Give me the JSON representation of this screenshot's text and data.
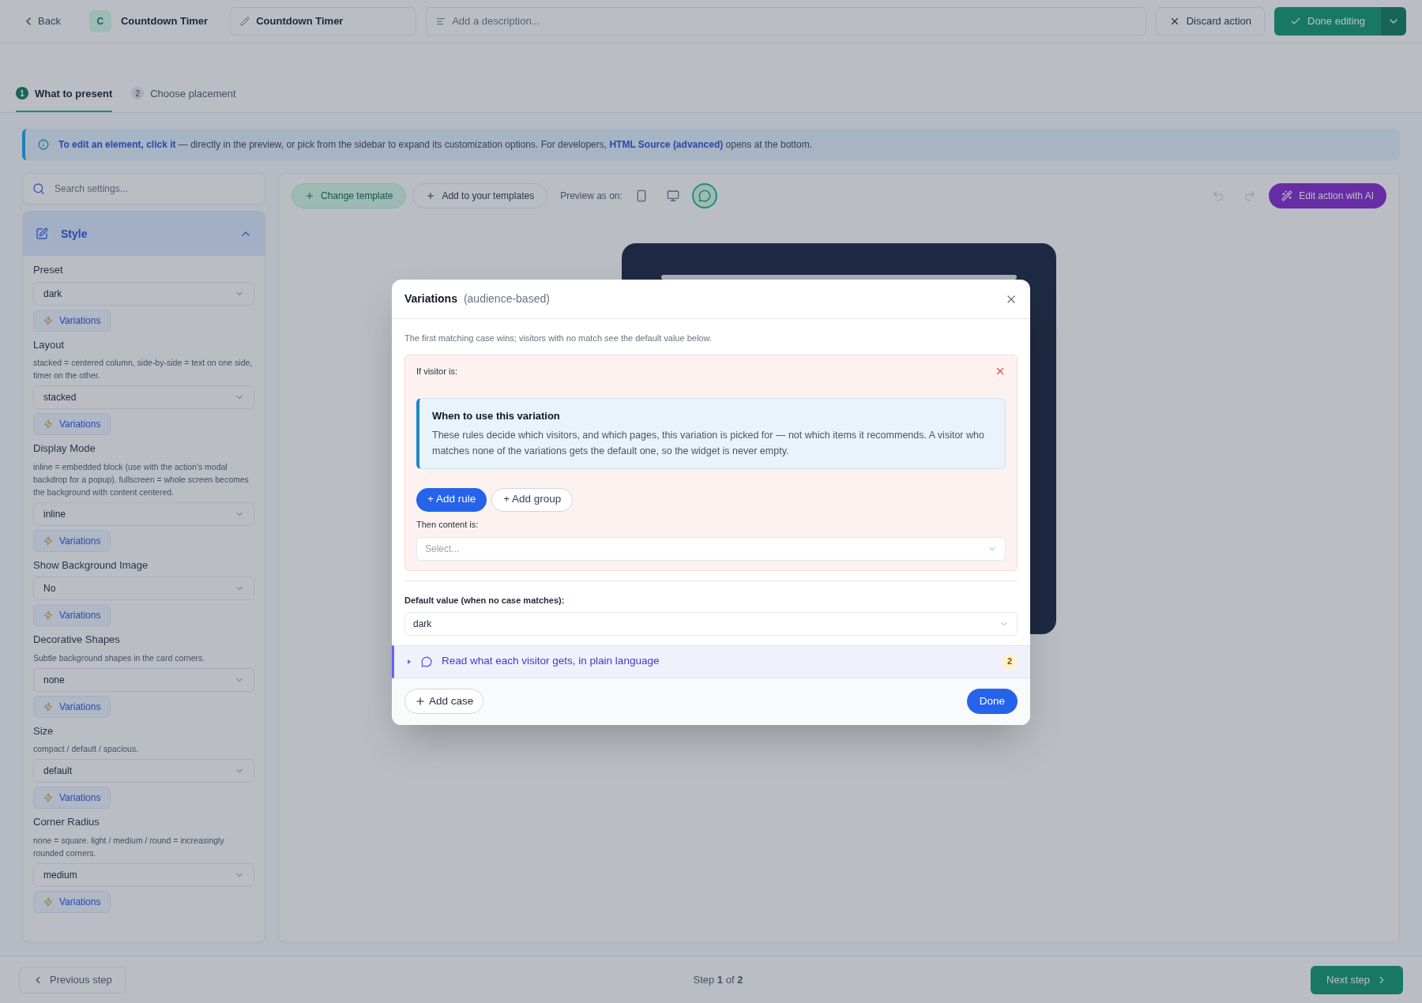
{
  "top_bar": {
    "back": "Back",
    "avatar": "C",
    "name": "Countdown Timer",
    "title_value": "Countdown Timer",
    "description_placeholder": "Add a description...",
    "discard": "Discard action",
    "done": "Done editing"
  },
  "steps": [
    {
      "number": "1",
      "label": "What to present",
      "selected": true
    },
    {
      "number": "2",
      "label": "Choose placement",
      "selected": false
    }
  ],
  "info_bar": "**To edit an element, click it** — directly in the preview, or pick from the sidebar to expand its customization options. For developers, **HTML Source (advanced)** opens at the bottom.",
  "sidebar": {
    "search_placeholder": "Search settings...",
    "section": {
      "title": "Style",
      "expanded": true
    },
    "fields": [
      {
        "label": "Preset",
        "value": "dark",
        "variations": "Variations"
      },
      {
        "label": "Layout",
        "description": "stacked = centered column, side-by-side = text on one side, timer on the other.",
        "value": "stacked",
        "variations": "Variations"
      },
      {
        "label": "Display Mode",
        "description": "inline = embedded block (use with the action's modal backdrop for a popup). fullscreen = whole screen becomes the background with content centered.",
        "value": "inline",
        "variations": "Variations"
      },
      {
        "label": "Show Background Image",
        "value": "No",
        "variations": "Variations"
      },
      {
        "label": "Decorative Shapes",
        "description": "Subtle background shapes in the card corners.",
        "value": "none",
        "variations": "Variations"
      },
      {
        "label": "Size",
        "description": "compact / default / spacious.",
        "value": "default",
        "variations": "Variations"
      },
      {
        "label": "Corner Radius",
        "description": "none = square. light / medium / round = increasingly rounded corners.",
        "value": "medium",
        "variations": "Variations"
      }
    ]
  },
  "toolbar": {
    "change_template": "Change template",
    "add_template": "Add to your templates",
    "preview_label": "Preview as on:",
    "devices": [
      {
        "kind": "phone",
        "selected": false
      },
      {
        "kind": "desktop",
        "selected": false
      },
      {
        "kind": "widget",
        "selected": true
      }
    ],
    "edit_ai": "Edit action with AI"
  },
  "footer": {
    "previous": "Previous step",
    "step": "Step **1** of **2**",
    "next": "Next step"
  },
  "modal": {
    "title": "Variations",
    "subtitle": "(audience-based)",
    "intro": "The first matching case wins; visitors with no match see the default value below.",
    "cases": [
      {
        "condition_label": "If visitor is:",
        "hint_title": "When to use this variation",
        "hint_text": "These rules decide which visitors, and which pages, this variation is picked for — not which items it recommends. A visitor who matches none of the variations gets the default one, so the widget is never empty.",
        "add_rule": "+ Add rule",
        "add_group": "+ Add group",
        "content_label": "Then content is:",
        "content_placeholder": "Select..."
      }
    ],
    "default_label": "Default value (when no case matches):",
    "default_value": "dark",
    "summary": {
      "text": "Read what each visitor gets, in plain language",
      "count": "2",
      "expanded": false
    },
    "add_case": "Add case",
    "done": "Done"
  }
}
